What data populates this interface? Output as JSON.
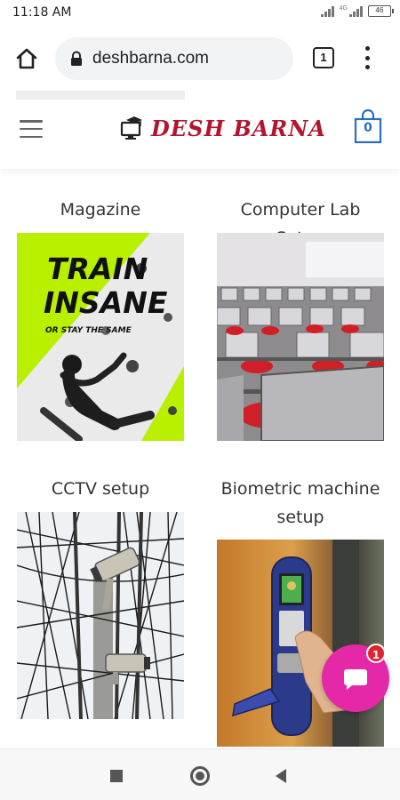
{
  "status": {
    "time": "11:18 AM",
    "battery": "46"
  },
  "browser": {
    "url": "deshbarna.com",
    "tab_count": "1"
  },
  "site": {
    "logo_text": "DESH BARNA",
    "cart_count": "0"
  },
  "products": [
    {
      "title": "Magazine",
      "image": "magazine-cover",
      "image_text": [
        "TRAIN",
        "INSANE",
        "OR STAY THE SAME"
      ]
    },
    {
      "title": "Computer Lab Setup",
      "image": "computer-lab-photo"
    },
    {
      "title": "CCTV setup",
      "image": "cctv-photo"
    },
    {
      "title": "Biometric machine setup",
      "image": "biometric-lock-photo"
    }
  ],
  "chat": {
    "badge": "1"
  },
  "colors": {
    "brand": "#b3152e",
    "cart": "#2a6fbf",
    "chat": "#e428a8",
    "badge": "#e0232f",
    "magazine_accent": "#b8f000"
  }
}
